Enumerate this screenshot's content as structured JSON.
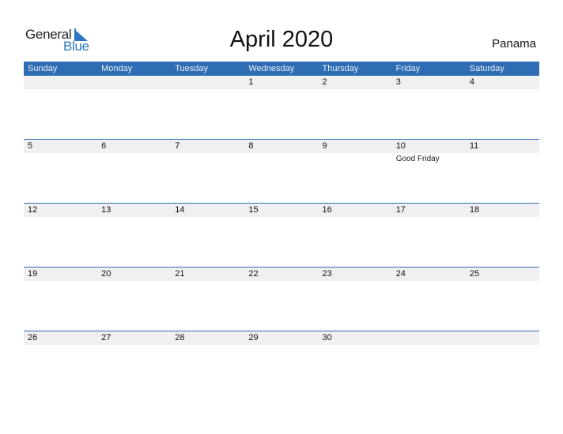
{
  "logo": {
    "line1": "General",
    "line2": "Blue",
    "brand_color": "#2a77c4"
  },
  "title": "April 2020",
  "country": "Panama",
  "header_color": "#2e6db3",
  "weekdays": [
    "Sunday",
    "Monday",
    "Tuesday",
    "Wednesday",
    "Thursday",
    "Friday",
    "Saturday"
  ],
  "weeks": [
    [
      {
        "day": ""
      },
      {
        "day": ""
      },
      {
        "day": ""
      },
      {
        "day": "1"
      },
      {
        "day": "2"
      },
      {
        "day": "3"
      },
      {
        "day": "4"
      }
    ],
    [
      {
        "day": "5"
      },
      {
        "day": "6"
      },
      {
        "day": "7"
      },
      {
        "day": "8"
      },
      {
        "day": "9"
      },
      {
        "day": "10",
        "event": "Good Friday"
      },
      {
        "day": "11"
      }
    ],
    [
      {
        "day": "12"
      },
      {
        "day": "13"
      },
      {
        "day": "14"
      },
      {
        "day": "15"
      },
      {
        "day": "16"
      },
      {
        "day": "17"
      },
      {
        "day": "18"
      }
    ],
    [
      {
        "day": "19"
      },
      {
        "day": "20"
      },
      {
        "day": "21"
      },
      {
        "day": "22"
      },
      {
        "day": "23"
      },
      {
        "day": "24"
      },
      {
        "day": "25"
      }
    ],
    [
      {
        "day": "26"
      },
      {
        "day": "27"
      },
      {
        "day": "28"
      },
      {
        "day": "29"
      },
      {
        "day": "30"
      },
      {
        "day": ""
      },
      {
        "day": ""
      }
    ]
  ]
}
